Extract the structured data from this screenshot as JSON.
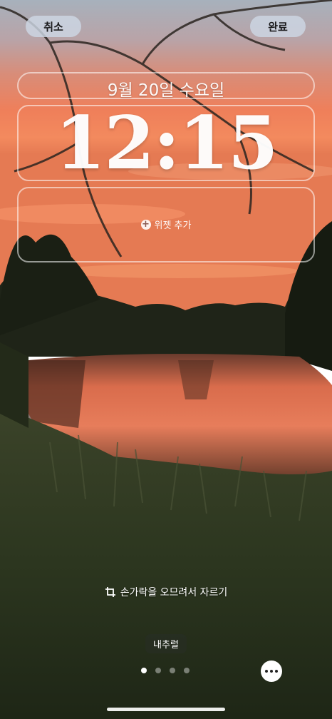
{
  "toolbar": {
    "cancel_label": "취소",
    "done_label": "완료"
  },
  "lockscreen": {
    "date": "9월 20일 수요일",
    "time": "12:15",
    "add_widget_label": "위젯 추가"
  },
  "crop_hint": "손가락을 오므려서 자르기",
  "album_label": "내추럴",
  "pager": {
    "count": 4,
    "active_index": 0
  },
  "icons": {
    "crop": "crop-icon",
    "add": "plus-circle-icon",
    "more": "more-icon"
  },
  "colors": {
    "sky_top": "#a9b4bf",
    "sunset": "#f07a55",
    "grass": "#2f3a24",
    "pill_bg": "#cdd7e4"
  }
}
